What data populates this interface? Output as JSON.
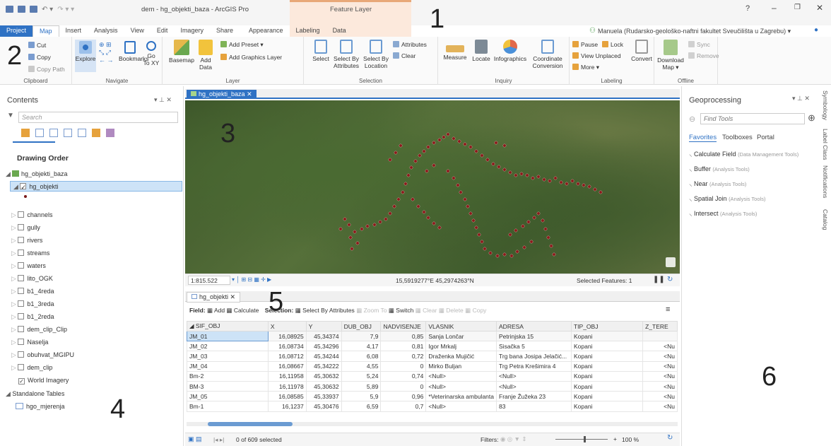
{
  "app": {
    "title": "dem - hg_objekti_baza - ArcGIS Pro",
    "context_tab": "Feature Layer",
    "user": "Manuela (Rudarsko-geološko-naftni fakultet Sveučilišta u Zagrebu) ▾",
    "help": "?"
  },
  "tabs": [
    "Project",
    "Map",
    "Insert",
    "Analysis",
    "View",
    "Edit",
    "Imagery",
    "Share",
    "Appearance",
    "Labeling",
    "Data"
  ],
  "ribbon": {
    "clipboard": {
      "label": "Clipboard",
      "paste": "Paste",
      "cut": "Cut",
      "copy": "Copy",
      "copy_path": "Copy Path"
    },
    "navigate": {
      "label": "Navigate",
      "explore": "Explore",
      "bookmarks": "Bookmarks",
      "goto": "Go\nTo XY"
    },
    "layer": {
      "label": "Layer",
      "basemap": "Basemap",
      "add_data": "Add\nData",
      "add_preset": "Add Preset ▾",
      "add_graphics": "Add Graphics Layer"
    },
    "selection": {
      "label": "Selection",
      "select": "Select",
      "by_attr": "Select By\nAttributes",
      "by_loc": "Select By\nLocation",
      "attributes": "Attributes",
      "clear": "Clear"
    },
    "inquiry": {
      "label": "Inquiry",
      "measure": "Measure",
      "locate": "Locate",
      "infographics": "Infographics",
      "coord": "Coordinate\nConversion"
    },
    "labeling": {
      "label": "Labeling",
      "pause": "Pause",
      "lock": "Lock",
      "view_unplaced": "View Unplaced",
      "more": "More ▾",
      "convert": "Convert"
    },
    "offline": {
      "label": "Offline",
      "download": "Download\nMap ▾",
      "sync": "Sync",
      "remove": "Remove"
    }
  },
  "contents": {
    "title": "Contents",
    "search_placeholder": "Search",
    "drawing_order": "Drawing Order",
    "map": "hg_objekti_baza",
    "layer": "hg_objekti",
    "layers": [
      "channels",
      "gully",
      "rivers",
      "streams",
      "waters",
      "lito_OGK",
      "b1_4reda",
      "b1_3reda",
      "b1_2reda",
      "dem_clip_Clip",
      "Naselja",
      "obuhvat_MGIPU",
      "dem_clip",
      "World Imagery"
    ],
    "standalone": "Standalone Tables",
    "table": "hgo_mjerenja"
  },
  "map": {
    "tab": "hg_objekti_baza",
    "scale": "1:815.522",
    "coords": "15,5919277°E 45,2974263°N",
    "selected": "Selected Features: 1"
  },
  "attr": {
    "tab": "hg_objekti",
    "field": "Field:",
    "add": "Add",
    "calculate": "Calculate",
    "selection": "Selection:",
    "select_by_attr": "Select By Attributes",
    "zoom_to": "Zoom To",
    "switch": "Switch",
    "clear": "Clear",
    "delete": "Delete",
    "copy": "Copy",
    "columns": [
      "SIF_OBJ",
      "X",
      "Y",
      "DUB_OBJ",
      "NADVISENJE",
      "VLASNIK",
      "ADRESA",
      "TIP_OBJ",
      "Z_TERE"
    ],
    "rows": [
      [
        "JM_01",
        "16,08925",
        "45,34374",
        "7,9",
        "0,85",
        "Sanja Lončar",
        "Petrinjska 15",
        "Kopani",
        ""
      ],
      [
        "JM_02",
        "16,08734",
        "45,34296",
        "4,17",
        "0,81",
        "Igor Mrkalj",
        "Sisačka 5",
        "Kopani",
        "<Nu"
      ],
      [
        "JM_03",
        "16,08712",
        "45,34244",
        "6,08",
        "0,72",
        "Draženka Mujičić",
        "Trg bana Josipa Jelačić...",
        "Kopani",
        "<Nu"
      ],
      [
        "JM_04",
        "16,08667",
        "45,34222",
        "4,55",
        "0",
        "Mirko Buljan",
        "Trg Petra Krešimira 4",
        "Kopani",
        "<Nu"
      ],
      [
        "Bm-2",
        "16,11958",
        "45,30632",
        "5,24",
        "0,74",
        "<Null>",
        "<Null>",
        "Kopani",
        "<Nu"
      ],
      [
        "BM-3",
        "16,11978",
        "45,30632",
        "5,89",
        "0",
        "<Null>",
        "<Null>",
        "Kopani",
        "<Nu"
      ],
      [
        "JM_05",
        "16,08585",
        "45,33937",
        "5,9",
        "0,96",
        "*Veterinarska ambulanta",
        "Franje Žužeka 23",
        "Kopani",
        "<Nu"
      ],
      [
        "Bm-1",
        "16,1237",
        "45,30476",
        "6,59",
        "0,7",
        "<Null>",
        "83",
        "Kopani",
        "<Nu"
      ]
    ],
    "footer": "0 of 609 selected",
    "filters": "Filters:",
    "zoom": "100 %"
  },
  "gp": {
    "title": "Geoprocessing",
    "search": "Find Tools",
    "tabs": [
      "Favorites",
      "Toolboxes",
      "Portal"
    ],
    "tools": [
      {
        "name": "Calculate Field",
        "tb": "(Data Management Tools)"
      },
      {
        "name": "Buffer",
        "tb": "(Analysis Tools)"
      },
      {
        "name": "Near",
        "tb": "(Analysis Tools)"
      },
      {
        "name": "Spatial Join",
        "tb": "(Analysis Tools)"
      },
      {
        "name": "Intersect",
        "tb": "(Analysis Tools)"
      }
    ]
  },
  "side_tabs": [
    "Symbology",
    "Label Class",
    "Notifications",
    "Catalog"
  ],
  "annotations": [
    "1",
    "2",
    "3",
    "4",
    "5",
    "6"
  ]
}
